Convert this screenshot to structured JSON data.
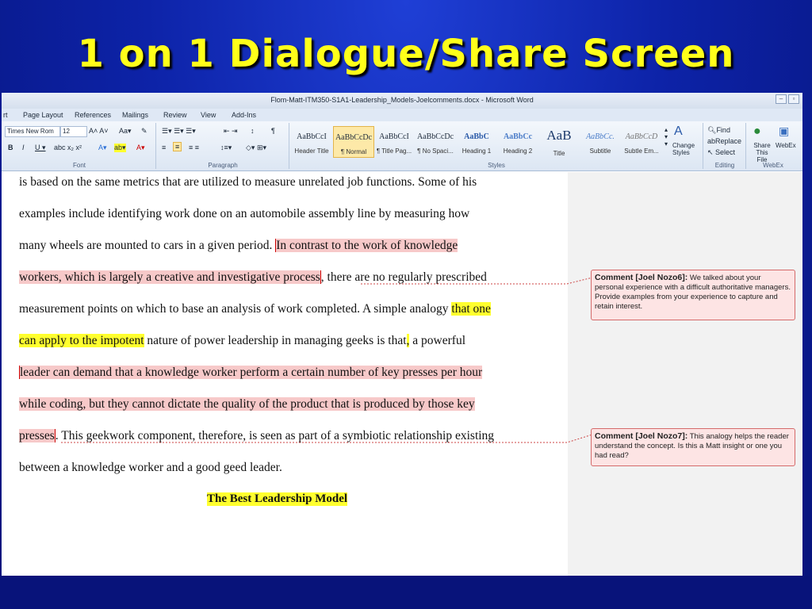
{
  "slide": {
    "title": "1 on 1 Dialogue/Share Screen"
  },
  "window": {
    "title": "Flom-Matt-ITM350-S1A1-Leadership_Models-Joelcomments.docx - Microsoft Word"
  },
  "tabs": [
    "rt",
    "Page Layout",
    "References",
    "Mailings",
    "Review",
    "View",
    "Add-Ins"
  ],
  "ribbon": {
    "font": {
      "name": "Times New Rom",
      "size": "12",
      "label": "Font"
    },
    "paragraph_label": "Paragraph",
    "styles_label": "Styles",
    "styles": [
      {
        "sample": "AaBbCcI",
        "name": "Header Title"
      },
      {
        "sample": "AaBbCcDc",
        "name": "¶ Normal"
      },
      {
        "sample": "AaBbCcI",
        "name": "¶ Title Pag..."
      },
      {
        "sample": "AaBbCcDc",
        "name": "¶ No Spaci..."
      },
      {
        "sample": "AaBbC",
        "name": "Heading 1"
      },
      {
        "sample": "AaBbCc",
        "name": "Heading 2"
      },
      {
        "sample": "AaB",
        "name": "Title"
      },
      {
        "sample": "AaBbCc.",
        "name": "Subtitle"
      },
      {
        "sample": "AaBbCcD",
        "name": "Subtle Em..."
      }
    ],
    "change_styles": "Change Styles",
    "editing": {
      "find": "Find",
      "replace": "Replace",
      "select": "Select",
      "label": "Editing"
    },
    "webex": {
      "share": "Share This File",
      "webex": "WebEx",
      "label": "WebEx"
    }
  },
  "document": {
    "line1": "is based on the same metrics that are utilized to measure unrelated job functions.  Some of his",
    "line2": "examples include identifying work done on an automobile assembly line by measuring how",
    "line3_a": "many wheels are mounted to cars in a given period.  ",
    "line3_b": "In contrast to the work of knowledge",
    "line4_a": "workers, which is largely a creative and investigative process",
    "line4_b": ", there are no regularly prescribed",
    "line5_a": "measurement points on which to base an analysis of work completed.  A simple analogy ",
    "line5_b": "that one",
    "line6_a": "can apply to the impotent",
    "line6_b": " nature of power leadership in managing geeks is that",
    "line6_c": ",",
    "line6_d": " a powerful",
    "line7": "leader can demand that a knowledge worker perform a certain number of key presses per hour",
    "line8_a": "while coding, but they cannot dictate the quality of the product that is produced by those key",
    "line9_a": "presses",
    "line9_b": ".  This geekwork component, therefore, is seen as part of a symbiotic relationship existing",
    "line10": "between a knowledge worker and a good geed leader.",
    "heading": "The Best Leadership Model"
  },
  "comments": [
    {
      "author": "Comment [Joel Nozo6]:",
      "text": "We talked about your personal experience with a difficult authoritative managers.  Provide examples from your experience to capture and retain interest."
    },
    {
      "author": "Comment [Joel Nozo7]:",
      "text": "This analogy helps the reader understand the concept.  Is this a Matt insight or one you had read?"
    }
  ]
}
